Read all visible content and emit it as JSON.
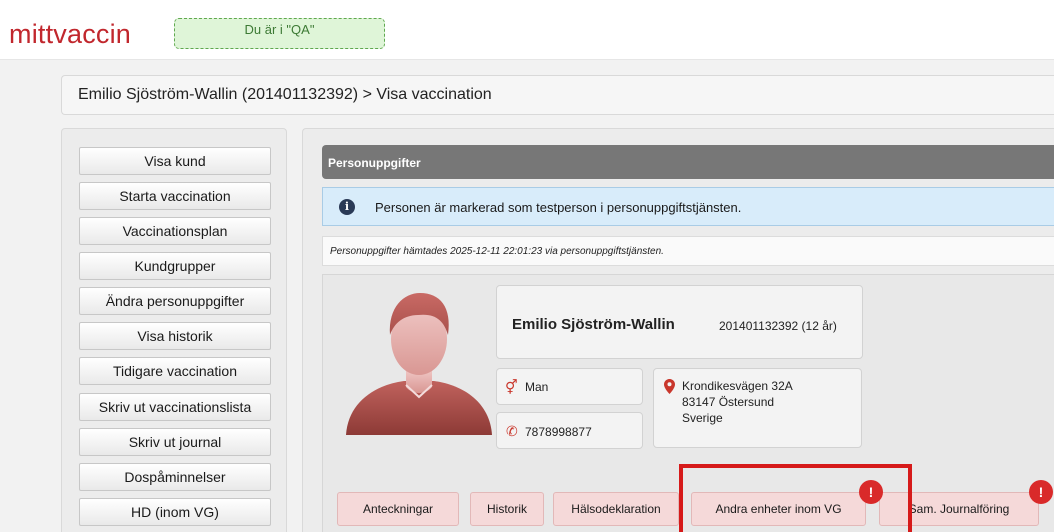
{
  "header": {
    "logo": "mittvaccin",
    "environment_badge": "Du är i \"QA\""
  },
  "breadcrumb": "Emilio Sjöström-Wallin (201401132392) > Visa vaccination",
  "sidebar": {
    "items": [
      {
        "label": "Visa kund"
      },
      {
        "label": "Starta vaccination"
      },
      {
        "label": "Vaccinationsplan"
      },
      {
        "label": "Kundgrupper"
      },
      {
        "label": "Ändra personuppgifter"
      },
      {
        "label": "Visa historik"
      },
      {
        "label": "Tidigare vaccination"
      },
      {
        "label": "Skriv ut vaccinationslista"
      },
      {
        "label": "Skriv ut journal"
      },
      {
        "label": "Dospåminnelser"
      },
      {
        "label": "HD (inom VG)"
      }
    ]
  },
  "main": {
    "section_title": "Personuppgifter",
    "info_message": "Personen är markerad som testperson i personuppgiftstjänsten.",
    "fetched_note": "Personuppgifter hämtades 2025-12-11 22:01:23 via personuppgiftstjänsten."
  },
  "person": {
    "name": "Emilio Sjöström-Wallin",
    "id_age": "201401132392 (12 år)",
    "gender": "Man",
    "phone": "7878998877",
    "address_line1": "Krondikesvägen 32A",
    "address_line2": "83147 Östersund",
    "address_country": "Sverige"
  },
  "tabs": [
    {
      "label": "Anteckningar"
    },
    {
      "label": "Historik"
    },
    {
      "label": "Hälsodeklaration"
    },
    {
      "label": "Andra enheter inom VG"
    },
    {
      "label": "Sam. Journalföring"
    }
  ],
  "alert_badges": [
    "!",
    "!"
  ],
  "colors": {
    "brand": "#c1272d",
    "tab_background": "#f5d9d9",
    "alert": "#d92a2a",
    "highlight_frame": "#d61a1a",
    "info_background": "#d8ecfa"
  }
}
